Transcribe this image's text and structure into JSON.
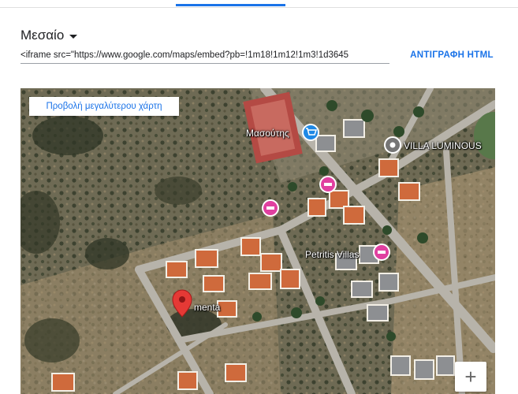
{
  "dialog": {
    "size_label": "Μεσαίο",
    "embed_code": "<iframe src=\"https://www.google.com/maps/embed?pb=!1m18!1m12!1m3!1d3645",
    "copy_label": "ΑΝΤΙΓΡΑΦΗ HTML"
  },
  "map": {
    "view_larger_label": "Προβολή μεγαλύτερου χάρτη",
    "places": {
      "masoutis": "Μασούτης",
      "villa": "VILLA LUMINOUS",
      "petritis": "Petritis Villas",
      "menta": "menta"
    },
    "zoom_in_label": "+"
  },
  "colors": {
    "accent": "#1a73e8",
    "pin_red": "#e53935",
    "hotel_pink": "#e040a0",
    "shop_blue": "#1e88e5",
    "landmark_gray": "#757575"
  }
}
